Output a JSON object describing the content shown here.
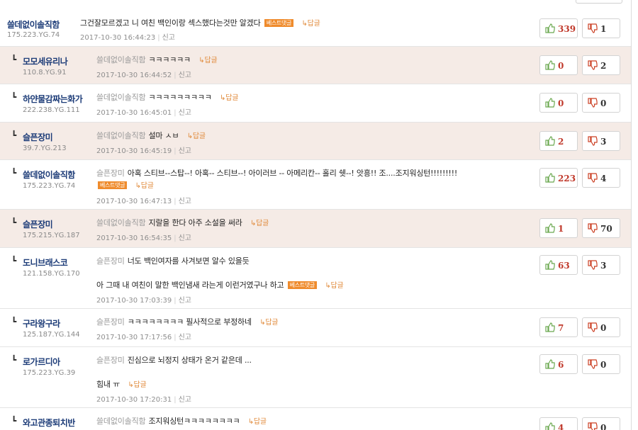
{
  "ui": {
    "reply_label": "↳답글",
    "report_label": "신고",
    "best_badge": "베스트댓글"
  },
  "comments": [
    {
      "nick": "쓸데없이솔직함",
      "ip": "175.223.YG.74",
      "target": "",
      "text": "그건잘모르겠고 니 여친 백인이랑 섹스했다는것만 알겠다",
      "text2": "",
      "date": "2017-10-30 16:44:23",
      "up": "339",
      "down": "1"
    },
    {
      "nick": "모모세유리나",
      "ip": "110.8.YG.91",
      "target": "쓸데없이솔직함",
      "text": "ㅋㅋㅋㅋㅋㅋ",
      "text2": "",
      "date": "2017-10-30 16:44:52",
      "up": "0",
      "down": "2"
    },
    {
      "nick": "하얀물감짜는화가",
      "ip": "222.238.YG.111",
      "target": "쓸데없이솔직함",
      "text": "ㅋㅋㅋㅋㅋㅋㅋㅋㅋ",
      "text2": "",
      "date": "2017-10-30 16:45:01",
      "up": "0",
      "down": "0"
    },
    {
      "nick": "슬픈장미",
      "ip": "39.7.YG.213",
      "target": "쓸데없이솔직함",
      "text": "설마 ㅅㅂ",
      "text2": "",
      "date": "2017-10-30 16:45:19",
      "up": "2",
      "down": "3"
    },
    {
      "nick": "쓸데없이솔직함",
      "ip": "175.223.YG.74",
      "target": "슬픈장미",
      "text": "아혹 스티브--스탑--! 아혹-- 스티브--! 아이러브 -- 아메리칸-- 홀리 쉣--! 앗흥!! 조....조지워싱턴!!!!!!!!!",
      "text2": "",
      "date": "2017-10-30 16:47:13",
      "up": "223",
      "down": "4"
    },
    {
      "nick": "슬픈장미",
      "ip": "175.215.YG.187",
      "target": "쓸데없이솔직함",
      "text": "지랄을 한다 아주 소설을 써라",
      "text2": "",
      "date": "2017-10-30 16:54:35",
      "up": "1",
      "down": "70"
    },
    {
      "nick": "도니브래스코",
      "ip": "121.158.YG.170",
      "target": "슬픈장미",
      "text": "너도 백인여자를 사겨보면 알수 있을듯",
      "text2": "아 그때 내 여친이 말한 백인냄새 라는게 이런거였구나 하고",
      "date": "2017-10-30 17:03:39",
      "up": "63",
      "down": "3"
    },
    {
      "nick": "구라왕구라",
      "ip": "125.187.YG.144",
      "target": "슬픈장미",
      "text": "ㅋㅋㅋㅋㅋㅋㅋㅋ 필사적으로 부정하네",
      "text2": "",
      "date": "2017-10-30 17:17:56",
      "up": "7",
      "down": "0"
    },
    {
      "nick": "로가르디아",
      "ip": "175.223.YG.39",
      "target": "슬픈장미",
      "text": "진심으로 뇌정지 상태가 온거 같은데 ...",
      "text2": "힘내 ㅠ",
      "date": "2017-10-30 17:20:31",
      "up": "6",
      "down": "0"
    },
    {
      "nick": "와고관종퇴치반",
      "ip": "",
      "target": "쓸데없이솔직함",
      "text": "조지워싱턴ㅋㅋㅋㅋㅋㅋㅋㅋ",
      "text2": "",
      "date": "",
      "up": "4",
      "down": "0"
    }
  ]
}
